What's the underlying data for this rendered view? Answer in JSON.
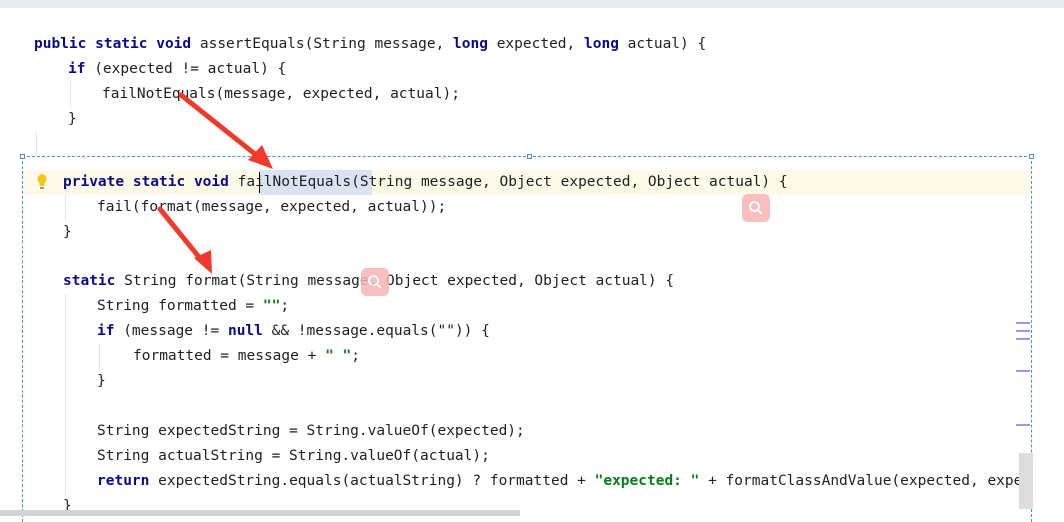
{
  "top_code": {
    "line1": {
      "kw1": "public static void",
      "rest": " assertEquals(String message, ",
      "kw2": "long",
      "mid": " expected, ",
      "kw3": "long",
      "end": " actual) {"
    },
    "line2": {
      "kw": "if",
      "rest": " (expected != actual) {"
    },
    "line3": {
      "text": "failNotEquals(message, expected, actual);"
    },
    "line4": {
      "text": "}"
    }
  },
  "popup_code": {
    "line1": {
      "kw": "private static void",
      "sp": " ",
      "name": "failNotEquals",
      "rest": "(String message, Object expected, Object actual) {"
    },
    "line2": {
      "text": "fail(format(message, expected, actual));"
    },
    "line3": {
      "text": "}"
    },
    "line4": {
      "kw": "static",
      "rest": " String format(String message, Object expected, Object actual) {"
    },
    "line5": {
      "a": "String formatted = ",
      "str": "\"\"",
      "b": ";"
    },
    "line6": {
      "kw": "if",
      "a": " (message != ",
      "kw2": "null",
      "b": " && !message.equals(\"\")) {"
    },
    "line7": {
      "a": "formatted = message + ",
      "str": "\" \"",
      "b": ";"
    },
    "line8": {
      "text": "}"
    },
    "line9": {
      "text": "String expectedString = String.valueOf(expected);"
    },
    "line10": {
      "text": "String actualString = String.valueOf(actual);"
    },
    "line11": {
      "kw": "return",
      "a": " expectedString.equals(actualString) ? formatted + ",
      "str": "\"expected: \"",
      "b": " + formatClassAndValue(expected, expect"
    },
    "line12": {
      "text": "}"
    }
  },
  "icons": {
    "intention_bulb": "lightbulb-icon",
    "search": "search-icon",
    "annotation_arrow": "red-arrow"
  },
  "colors": {
    "keyword": "#0a0a8a",
    "string": "#067d17",
    "arrow": "#f0392b",
    "popup_border": "#4a90d9",
    "line_highlight": "#fdfbe8",
    "selection": "#dbe2f2"
  }
}
